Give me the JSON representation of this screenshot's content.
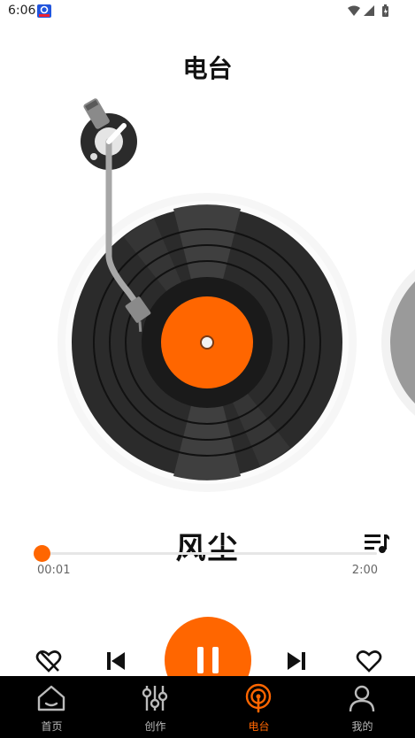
{
  "status_bar": {
    "time": "6:06"
  },
  "header": {
    "title": "电台"
  },
  "player": {
    "song_title": "风尘",
    "current_time": "00:01",
    "total_time": "2:00",
    "progress_fraction": 0.008
  },
  "bottom_nav": {
    "items": [
      {
        "label": "首页",
        "icon": "home-icon"
      },
      {
        "label": "创作",
        "icon": "sliders-icon"
      },
      {
        "label": "电台",
        "icon": "radio-icon"
      },
      {
        "label": "我的",
        "icon": "user-icon"
      }
    ],
    "active_index": 2
  },
  "colors": {
    "accent": "#ff6600",
    "nav_background": "#000000",
    "record": "#2b2b2b"
  }
}
